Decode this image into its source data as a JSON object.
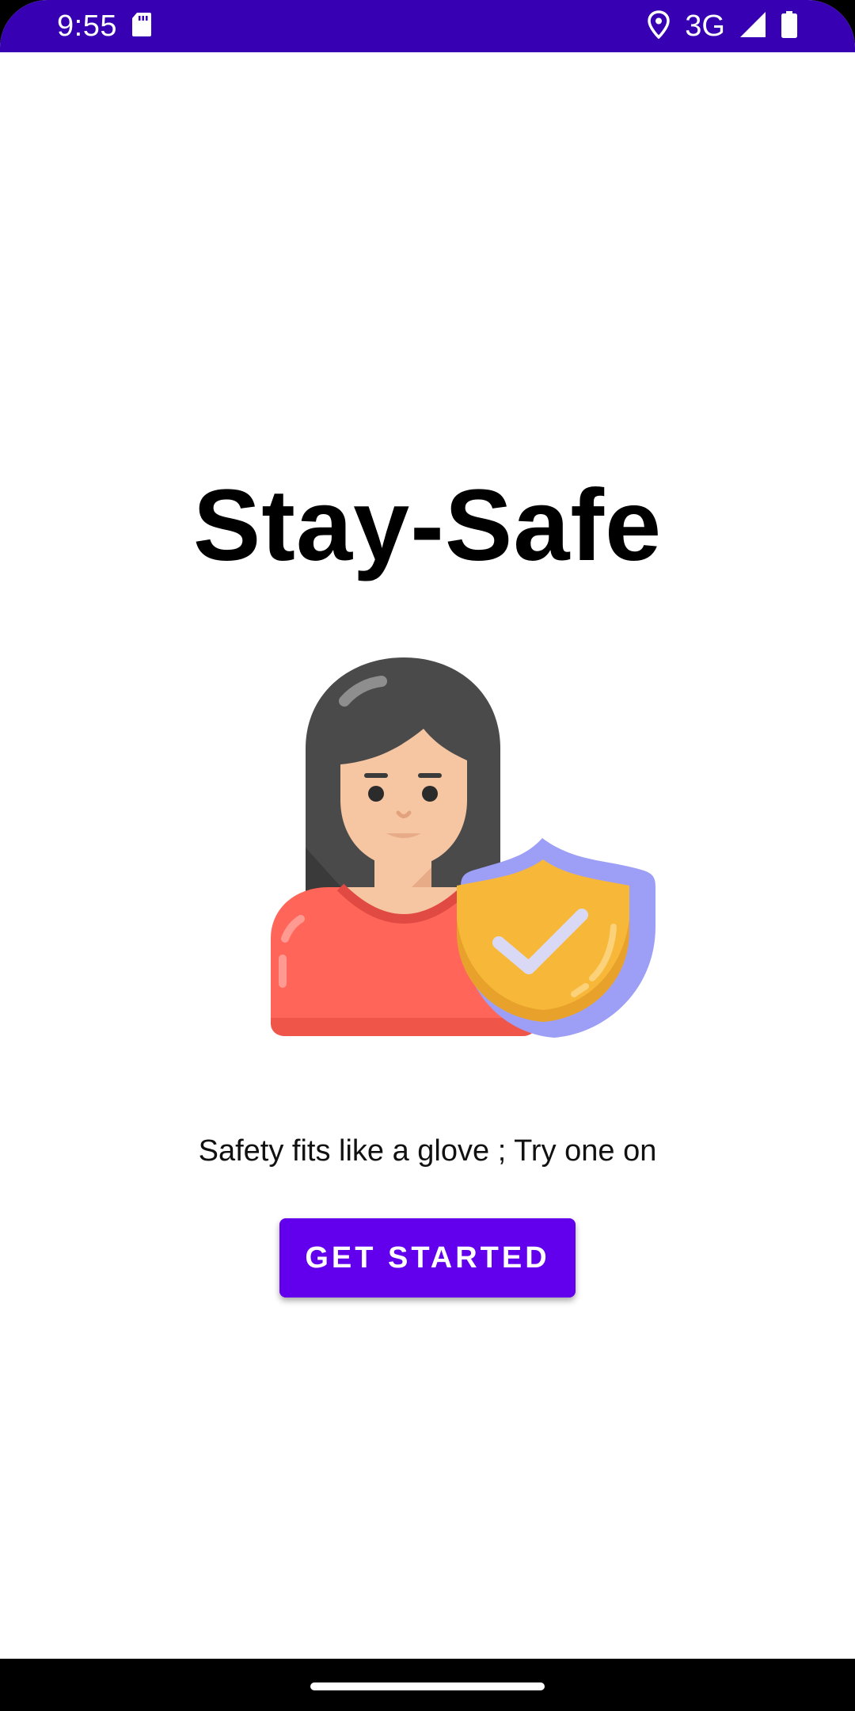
{
  "status_bar": {
    "time": "9:55",
    "network": "3G",
    "icons": [
      "sd-card-icon",
      "location-pin-icon",
      "signal-icon",
      "battery-icon"
    ],
    "background": "#3700b3"
  },
  "main": {
    "title": "Stay-Safe",
    "tagline": "Safety fits like a glove ; Try one on",
    "cta_label": "GET STARTED",
    "illustration": "woman-with-shield-icon"
  },
  "colors": {
    "accent": "#6200ee",
    "status_bar": "#3700b3",
    "shirt": "#ff6659",
    "shield_fill": "#f7b83a",
    "shield_rim": "#9c9ff5"
  }
}
